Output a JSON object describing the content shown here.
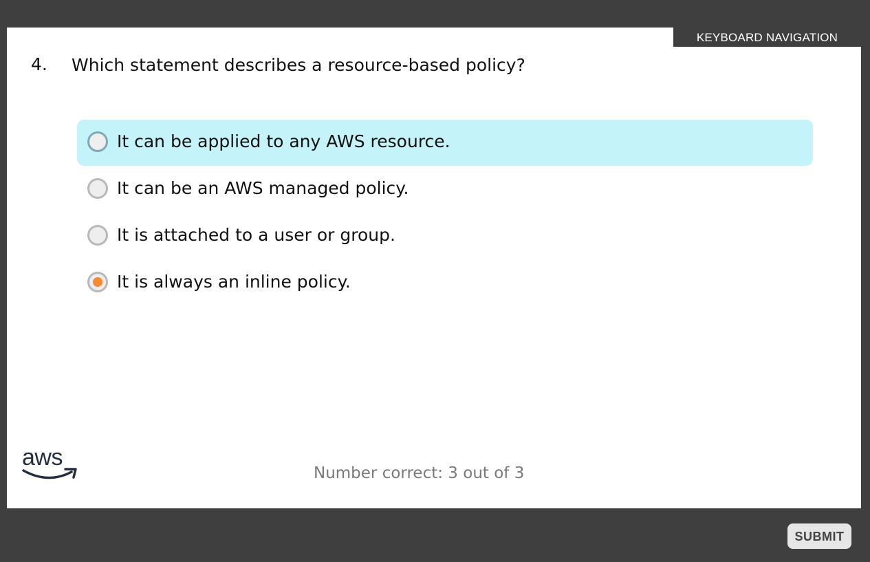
{
  "header": {
    "keyboard_navigation_label": "KEYBOARD NAVIGATION"
  },
  "question": {
    "number": "4.",
    "text": "Which statement describes a resource-based policy?"
  },
  "options": [
    {
      "label": "It can be applied to any AWS resource.",
      "selected": false,
      "hovered": true
    },
    {
      "label": "It can be an AWS managed policy.",
      "selected": false,
      "hovered": false
    },
    {
      "label": "It is attached to a user or group.",
      "selected": false,
      "hovered": false
    },
    {
      "label": "It is always an inline policy.",
      "selected": true,
      "hovered": false
    }
  ],
  "logo": {
    "text": "aws"
  },
  "score": {
    "text": "Number correct: 3 out of 3"
  },
  "footer": {
    "submit_label": "SUBMIT"
  },
  "colors": {
    "background": "#3f3f3f",
    "hover_highlight": "#c4f4f9",
    "selected_dot": "#f58a33",
    "logo_dark": "#232f3e"
  }
}
